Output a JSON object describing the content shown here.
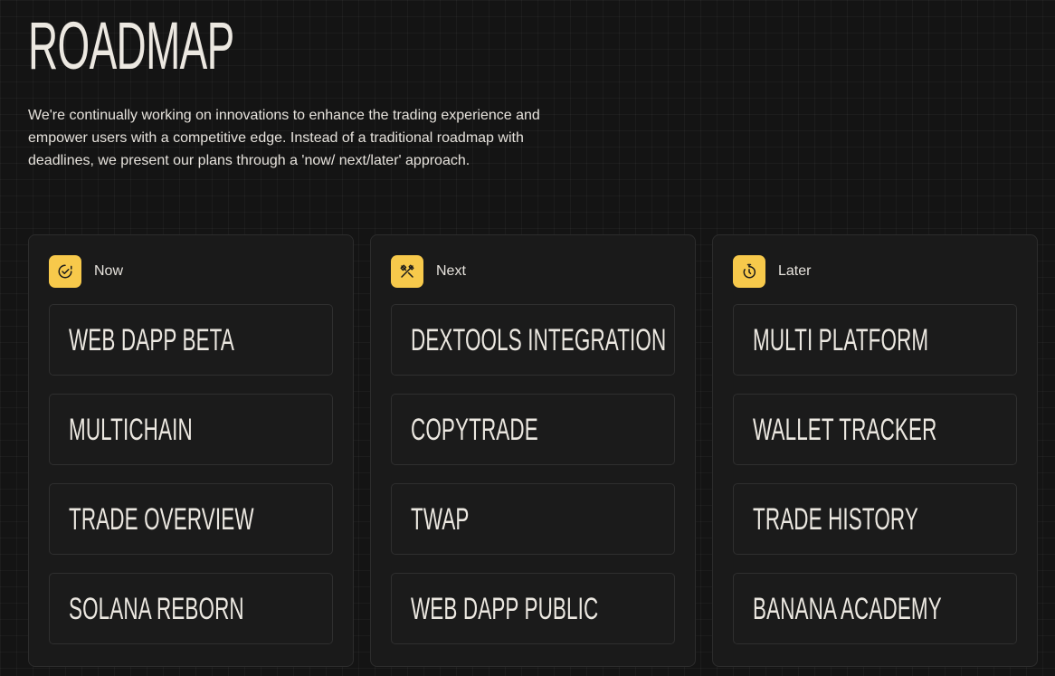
{
  "page": {
    "title": "ROADMAP",
    "intro": "We're continually working on innovations to enhance the trading experience and empower users with a competitive edge. Instead of a traditional roadmap with deadlines, we present our plans through a 'now/ next/later' approach."
  },
  "colors": {
    "background": "#141414",
    "card": "#1b1b1b",
    "accent": "#f7c94b",
    "text": "#ece8e1"
  },
  "columns": [
    {
      "label": "Now",
      "icon": "check-circle-icon",
      "items": [
        "WEB DAPP BETA",
        "MULTICHAIN",
        "TRADE OVERVIEW",
        "SOLANA REBORN"
      ]
    },
    {
      "label": "Next",
      "icon": "tools-icon",
      "items": [
        "DEXTOOLS INTEGRATION",
        "COPYTRADE",
        "TWAP",
        "WEB DAPP PUBLIC"
      ]
    },
    {
      "label": "Later",
      "icon": "timer-icon",
      "items": [
        "MULTI PLATFORM",
        "WALLET TRACKER",
        "TRADE HISTORY",
        "BANANA ACADEMY"
      ]
    }
  ]
}
